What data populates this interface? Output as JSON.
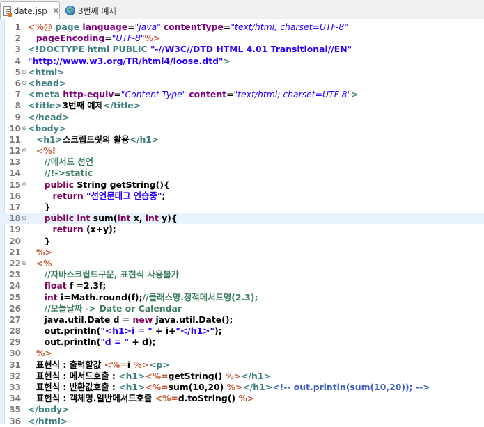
{
  "tabs": [
    {
      "label": "date.jsp",
      "icon": "jsp-file-icon",
      "active": true
    },
    {
      "label": "3번째 예제",
      "icon": "globe-icon",
      "active": false
    }
  ],
  "close_glyph": "✕",
  "fold_glyphs": {
    "collapse": "⊖",
    "expand": "⊕"
  },
  "current_line": 18,
  "lines": [
    {
      "n": "1",
      "fold": "",
      "tokens": [
        [
          "p",
          "<%@ "
        ],
        [
          "d",
          "page "
        ],
        [
          "a",
          "language"
        ],
        [
          "x",
          "="
        ],
        [
          "v",
          "\"java\""
        ],
        [
          "x",
          " "
        ],
        [
          "a",
          "contentType"
        ],
        [
          "x",
          "="
        ],
        [
          "v",
          "\"text/html; charset=UTF-8\""
        ]
      ]
    },
    {
      "n": "2",
      "fold": "",
      "tokens": [
        [
          "x",
          "   "
        ],
        [
          "a",
          "pageEncoding"
        ],
        [
          "x",
          "="
        ],
        [
          "v",
          "\"UTF-8\""
        ],
        [
          "p",
          "%>"
        ]
      ]
    },
    {
      "n": "3",
      "fold": "",
      "tokens": [
        [
          "d",
          "<!DOCTYPE html PUBLIC "
        ],
        [
          "s",
          "\"-//W3C//DTD HTML 4.01 Transitional//EN\""
        ]
      ]
    },
    {
      "n": "4",
      "fold": "",
      "tokens": [
        [
          "s",
          "\"http://www.w3.org/TR/html4/loose.dtd\""
        ],
        [
          "d",
          ">"
        ]
      ]
    },
    {
      "n": "5",
      "fold": "collapse",
      "tokens": [
        [
          "d",
          "<html>"
        ]
      ]
    },
    {
      "n": "6",
      "fold": "collapse",
      "tokens": [
        [
          "d",
          "<head>"
        ]
      ]
    },
    {
      "n": "7",
      "fold": "",
      "tokens": [
        [
          "d",
          "<meta "
        ],
        [
          "a",
          "http-equiv"
        ],
        [
          "x",
          "="
        ],
        [
          "v",
          "\"Content-Type\""
        ],
        [
          "x",
          " "
        ],
        [
          "a",
          "content"
        ],
        [
          "x",
          "="
        ],
        [
          "v",
          "\"text/html; charset=UTF-8\""
        ],
        [
          "d",
          ">"
        ]
      ]
    },
    {
      "n": "8",
      "fold": "",
      "tokens": [
        [
          "d",
          "<title>"
        ],
        [
          "t",
          "3번째 예제"
        ],
        [
          "d",
          "</title>"
        ]
      ]
    },
    {
      "n": "9",
      "fold": "",
      "tokens": [
        [
          "d",
          "</head>"
        ]
      ]
    },
    {
      "n": "10",
      "fold": "collapse",
      "tokens": [
        [
          "d",
          "<body>"
        ]
      ]
    },
    {
      "n": "11",
      "fold": "",
      "tokens": [
        [
          "x",
          "   "
        ],
        [
          "d",
          "<h1>"
        ],
        [
          "t",
          "스크립트릿의 활용"
        ],
        [
          "d",
          "</h1>"
        ]
      ]
    },
    {
      "n": "12",
      "fold": "collapse",
      "tokens": [
        [
          "x",
          "   "
        ],
        [
          "p",
          "<%!"
        ]
      ]
    },
    {
      "n": "13",
      "fold": "",
      "tokens": [
        [
          "x",
          "      "
        ],
        [
          "c",
          "//메서드 선언"
        ]
      ]
    },
    {
      "n": "14",
      "fold": "",
      "tokens": [
        [
          "x",
          "      "
        ],
        [
          "c",
          "//!->static"
        ]
      ]
    },
    {
      "n": "15",
      "fold": "collapse",
      "tokens": [
        [
          "x",
          "      "
        ],
        [
          "k",
          "public"
        ],
        [
          "t",
          " String getString(){"
        ]
      ]
    },
    {
      "n": "16",
      "fold": "",
      "tokens": [
        [
          "x",
          "         "
        ],
        [
          "k",
          "return"
        ],
        [
          "t",
          " "
        ],
        [
          "s",
          "\"선언문태그 연습중\""
        ],
        [
          "t",
          ";"
        ]
      ]
    },
    {
      "n": "17",
      "fold": "",
      "tokens": [
        [
          "x",
          "      "
        ],
        [
          "t",
          "}"
        ]
      ]
    },
    {
      "n": "18",
      "fold": "collapse",
      "tokens": [
        [
          "x",
          "      "
        ],
        [
          "k",
          "public"
        ],
        [
          "t",
          " "
        ],
        [
          "k",
          "int"
        ],
        [
          "t",
          " sum("
        ],
        [
          "k",
          "int"
        ],
        [
          "t",
          " x, "
        ],
        [
          "k",
          "int"
        ],
        [
          "t",
          " y){"
        ]
      ]
    },
    {
      "n": "19",
      "fold": "",
      "tokens": [
        [
          "x",
          "         "
        ],
        [
          "k",
          "return"
        ],
        [
          "t",
          " (x+y);"
        ]
      ]
    },
    {
      "n": "20",
      "fold": "",
      "tokens": [
        [
          "x",
          "      "
        ],
        [
          "t",
          "}"
        ]
      ]
    },
    {
      "n": "21",
      "fold": "",
      "tokens": [
        [
          "x",
          "   "
        ],
        [
          "p",
          "%>"
        ]
      ]
    },
    {
      "n": "22",
      "fold": "collapse",
      "tokens": [
        [
          "x",
          "   "
        ],
        [
          "p",
          "<%"
        ]
      ]
    },
    {
      "n": "23",
      "fold": "",
      "tokens": [
        [
          "x",
          "      "
        ],
        [
          "c",
          "//자바스크립트구문, 표현식 사용불가"
        ]
      ]
    },
    {
      "n": "24",
      "fold": "",
      "tokens": [
        [
          "x",
          "      "
        ],
        [
          "k",
          "float"
        ],
        [
          "t",
          " f =2.3f;"
        ]
      ]
    },
    {
      "n": "25",
      "fold": "",
      "tokens": [
        [
          "x",
          "      "
        ],
        [
          "k",
          "int"
        ],
        [
          "t",
          " i=Math.round(f);"
        ],
        [
          "c",
          "//클래스명.정적메서드명(2.3);"
        ]
      ]
    },
    {
      "n": "26",
      "fold": "",
      "tokens": [
        [
          "x",
          "      "
        ],
        [
          "c",
          "//오늘날짜 -> Date or Calendar"
        ]
      ]
    },
    {
      "n": "27",
      "fold": "",
      "tokens": [
        [
          "x",
          "      "
        ],
        [
          "t",
          "java.util.Date d = "
        ],
        [
          "k",
          "new"
        ],
        [
          "t",
          " java.util.Date();"
        ]
      ]
    },
    {
      "n": "28",
      "fold": "",
      "tokens": [
        [
          "x",
          "      "
        ],
        [
          "t",
          "out.println("
        ],
        [
          "s",
          "\"<h1>i = \""
        ],
        [
          "t",
          " + i+"
        ],
        [
          "s",
          "\"</h1>\""
        ],
        [
          "t",
          ");"
        ]
      ]
    },
    {
      "n": "29",
      "fold": "",
      "tokens": [
        [
          "x",
          "      "
        ],
        [
          "t",
          "out.println("
        ],
        [
          "s",
          "\"d = \""
        ],
        [
          "t",
          " + d);"
        ]
      ]
    },
    {
      "n": "30",
      "fold": "",
      "tokens": [
        [
          "x",
          "   "
        ],
        [
          "p",
          "%>"
        ]
      ]
    },
    {
      "n": "31",
      "fold": "",
      "tokens": [
        [
          "x",
          "   "
        ],
        [
          "t",
          "표현식 : 출력할값 "
        ],
        [
          "p",
          "<%="
        ],
        [
          "t",
          "i "
        ],
        [
          "p",
          "%>"
        ],
        [
          "d",
          "<p>"
        ]
      ]
    },
    {
      "n": "32",
      "fold": "",
      "tokens": [
        [
          "x",
          "   "
        ],
        [
          "t",
          "표현식 : 메서드호출 : "
        ],
        [
          "d",
          "<h1>"
        ],
        [
          "p",
          "<%="
        ],
        [
          "t",
          "getString() "
        ],
        [
          "p",
          "%>"
        ],
        [
          "d",
          "</h1>"
        ]
      ]
    },
    {
      "n": "33",
      "fold": "",
      "tokens": [
        [
          "x",
          "   "
        ],
        [
          "t",
          "표현식 : 반환값호출 : "
        ],
        [
          "d",
          "<h1>"
        ],
        [
          "p",
          "<%="
        ],
        [
          "t",
          "sum(10,20) "
        ],
        [
          "p",
          "%>"
        ],
        [
          "d",
          "</h1>"
        ],
        [
          "h",
          "<!-- out.println(sum(10,20)); -->"
        ]
      ]
    },
    {
      "n": "34",
      "fold": "",
      "tokens": [
        [
          "x",
          "   "
        ],
        [
          "t",
          "표현식 : 객체명.일반메서드호출 "
        ],
        [
          "p",
          "<%="
        ],
        [
          "t",
          "d.toString() "
        ],
        [
          "p",
          "%>"
        ]
      ]
    },
    {
      "n": "35",
      "fold": "",
      "tokens": [
        [
          "d",
          "</body>"
        ]
      ]
    },
    {
      "n": "36",
      "fold": "",
      "tokens": [
        [
          "d",
          "</html>"
        ]
      ]
    }
  ]
}
